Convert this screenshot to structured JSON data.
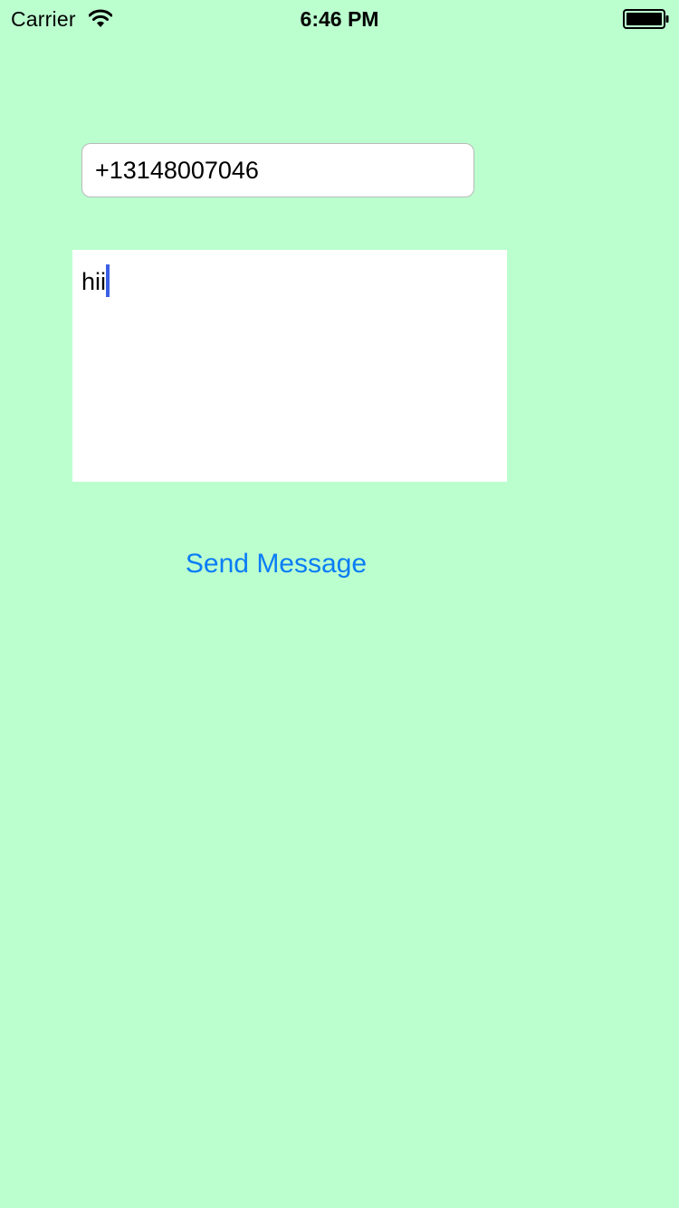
{
  "status_bar": {
    "carrier": "Carrier",
    "time": "6:46 PM",
    "wifi_icon": "wifi-icon",
    "battery_icon": "battery-icon"
  },
  "form": {
    "phone_value": "+13148007046",
    "message_value": "hii",
    "send_label": "Send Message"
  },
  "colors": {
    "background": "#bcffcf",
    "accent": "#0a7cf5",
    "caret": "#3a5fe5"
  }
}
